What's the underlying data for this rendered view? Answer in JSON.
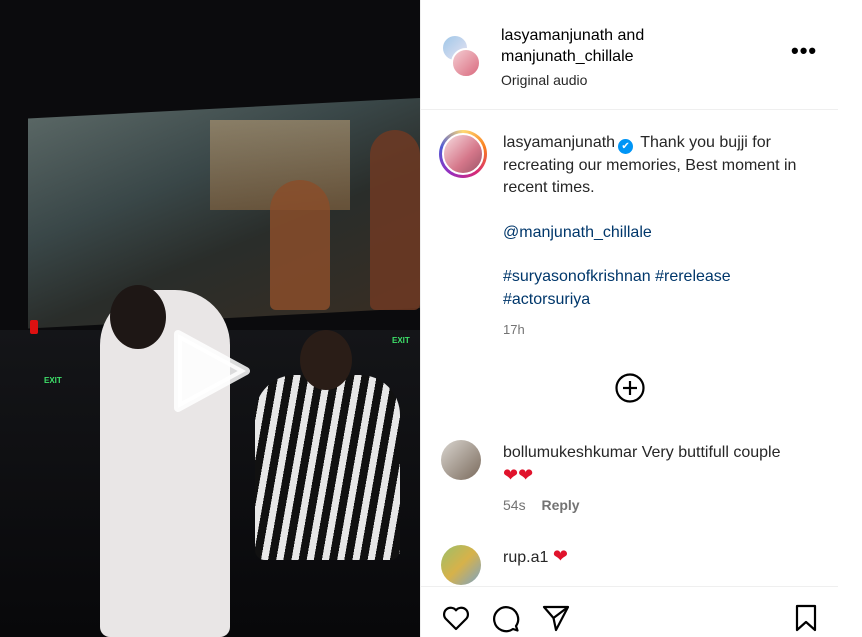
{
  "post": {
    "header_user1": "lasyamanjunath",
    "header_and": "and",
    "header_user2": "manjunath_chillale",
    "audio": "Original audio",
    "more": "•••"
  },
  "media": {
    "exit_label": "EXIT"
  },
  "caption": {
    "username": "lasyamanjunath",
    "verified_icon": "✔",
    "line1": "Thank you bujji for recreating our memories, Best moment in recent times.",
    "mention": "@manjunath_chillale",
    "hashtag1": "#suryasonofkrishnan",
    "hashtag2": "#rerelease",
    "hashtag3": "#actorsuriya",
    "time": "17h"
  },
  "comments": [
    {
      "username": "bollumukeshkumar",
      "text": "Very buttifull couple",
      "emoji": "❤❤",
      "time": "54s",
      "reply": "Reply"
    },
    {
      "username": "rup.a1",
      "emoji": "❤"
    }
  ],
  "icons": {
    "like": "heart-icon",
    "comment": "comment-icon",
    "share": "share-icon",
    "save": "bookmark-icon",
    "more_comments": "plus-circle-icon",
    "play": "play-icon"
  },
  "colors": {
    "verified": "#0095f6",
    "link": "#00376b",
    "heart": "#e0132c"
  }
}
